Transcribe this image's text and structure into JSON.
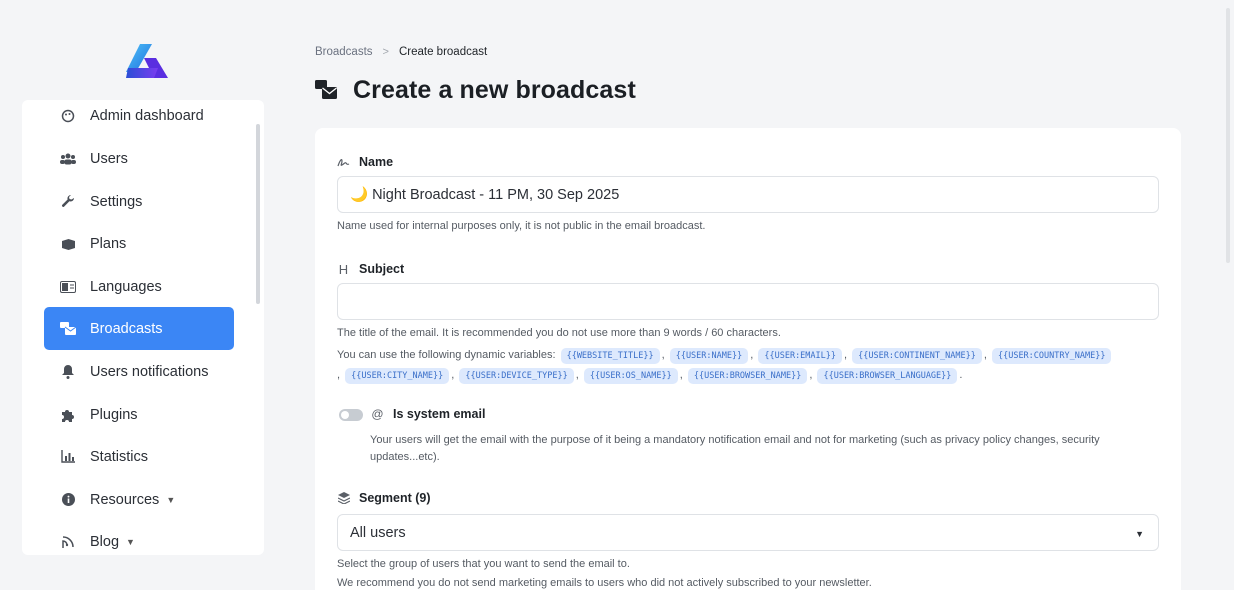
{
  "sidebar": {
    "items": [
      {
        "label": "Admin dashboard"
      },
      {
        "label": "Users"
      },
      {
        "label": "Settings"
      },
      {
        "label": "Plans"
      },
      {
        "label": "Languages"
      },
      {
        "label": "Broadcasts",
        "active": true
      },
      {
        "label": "Users notifications"
      },
      {
        "label": "Plugins"
      },
      {
        "label": "Statistics"
      },
      {
        "label": "Resources"
      },
      {
        "label": "Blog"
      }
    ]
  },
  "breadcrumb": {
    "parent": "Broadcasts",
    "separator": ">",
    "current": "Create broadcast"
  },
  "page": {
    "title": "Create a new broadcast"
  },
  "form": {
    "name": {
      "label": "Name",
      "value": "🌙 Night Broadcast - 11 PM, 30 Sep 2025",
      "help": "Name used for internal purposes only, it is not public in the email broadcast."
    },
    "subject": {
      "label": "Subject",
      "value": "",
      "help": "The title of the email. It is recommended you do not use more than 9 words / 60 characters.",
      "vars_intro": "You can use the following dynamic variables:",
      "variables": [
        "{{WEBSITE_TITLE}}",
        "{{USER:NAME}}",
        "{{USER:EMAIL}}",
        "{{USER:CONTINENT_NAME}}",
        "{{USER:COUNTRY_NAME}}",
        "{{USER:CITY_NAME}}",
        "{{USER:DEVICE_TYPE}}",
        "{{USER:OS_NAME}}",
        "{{USER:BROWSER_NAME}}",
        "{{USER:BROWSER_LANGUAGE}}"
      ]
    },
    "system_email": {
      "label": "Is system email",
      "enabled": false,
      "description": "Your users will get the email with the purpose of it being a mandatory notification email and not for marketing (such as privacy policy changes, security updates...etc)."
    },
    "segment": {
      "label": "Segment (9)",
      "selected": "All users",
      "help1": "Select the group of users that you want to send the email to.",
      "help2": "We recommend you do not send marketing emails to users who did not actively subscribed to your newsletter."
    }
  },
  "colors": {
    "accent": "#3b86f5",
    "chip_bg": "#dde9fd",
    "chip_text": "#3a6fc9"
  }
}
